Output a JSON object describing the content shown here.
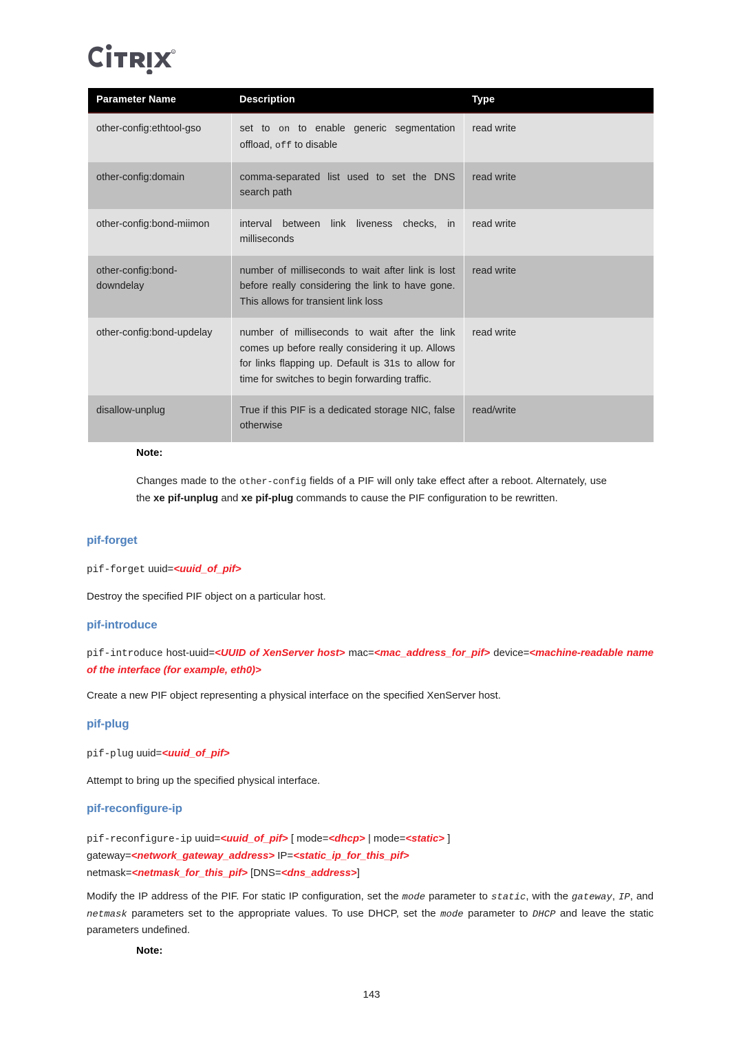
{
  "brand": {
    "logo_text": "CITRIX",
    "logo_color": "#4a4a55"
  },
  "theme": {
    "heading_blue": "#4f81bd",
    "placeholder_red": "#ee1c24",
    "row_light": "#e0e0e0",
    "row_dark": "#bfbfbf",
    "header_bg": "#000000"
  },
  "table": {
    "headers": [
      "Parameter Name",
      "Description",
      "Type"
    ],
    "rows": [
      {
        "name": "other-config:ethtool-gso",
        "desc_parts": [
          {
            "text": "set to ",
            "style": "normal"
          },
          {
            "text": "on",
            "style": "mono"
          },
          {
            "text": " to enable generic segmentation offload, ",
            "style": "normal"
          },
          {
            "text": "off",
            "style": "mono"
          },
          {
            "text": " to disable",
            "style": "normal"
          }
        ],
        "desc_plain": "set to on to enable generic segmentation offload, off to disable",
        "type": "read write",
        "shade": "light"
      },
      {
        "name": "other-config:domain",
        "desc_plain": "comma-separated list used to set the DNS search path",
        "type": "read write",
        "shade": "dark"
      },
      {
        "name": "other-config:bond-miimon",
        "desc_plain": "interval between link liveness checks, in milliseconds",
        "type": "read write",
        "shade": "light"
      },
      {
        "name": "other-config:bond-downdelay",
        "desc_plain": "number of milliseconds to wait after link is lost before really considering the link to have gone. This allows for transient link loss",
        "type": "read write",
        "shade": "dark"
      },
      {
        "name": "other-config:bond-updelay",
        "desc_plain": "number of milliseconds to wait after the link comes up before really considering it up. Allows for links flapping up. Default is 31s to allow for time for switches to begin forwarding traffic.",
        "type": "read write",
        "shade": "light"
      },
      {
        "name": "disallow-unplug",
        "desc_plain": "True if this PIF is a dedicated storage NIC, false otherwise",
        "type": "read/write",
        "shade": "dark"
      }
    ]
  },
  "note_top": {
    "label": "Note:",
    "line1_a": "Changes made to the ",
    "line1_mono": "other-config",
    "line1_b": " fields of a PIF will only take effect after a reboot. Alternately, use the ",
    "bold1": "xe pif-unplug",
    "mid": " and ",
    "bold2": "xe pif-plug",
    "line1_c": " commands to cause the PIF configuration to be rewritten."
  },
  "sections": {
    "pif_forget": {
      "heading": "pif-forget",
      "syntax_cmd": "pif-forget",
      "syntax_arg": "uuid=",
      "syntax_ph": "<uuid_of_pif>",
      "body": "Destroy the specified PIF object on a particular host."
    },
    "pif_introduce": {
      "heading": "pif-introduce",
      "syntax_cmd": "pif-introduce",
      "arg1": "host-uuid=",
      "ph1": "<UUID of XenServer host>",
      "arg2": "mac=",
      "ph2": "<mac_address_for_pif>",
      "arg3": "device=",
      "ph3": "<machine-readable name of the interface (for example, eth0)>",
      "body": "Create a new PIF object representing a physical interface on the specified XenServer host."
    },
    "pif_plug": {
      "heading": "pif-plug",
      "syntax_cmd": "pif-plug",
      "syntax_arg": "uuid=",
      "syntax_ph": "<uuid_of_pif>",
      "body": "Attempt to bring up the specified physical interface."
    },
    "pif_reconfigure_ip": {
      "heading": "pif-reconfigure-ip",
      "syntax_cmd": "pif-reconfigure-ip",
      "l1_arg": "uuid=",
      "l1_ph": "<uuid_of_pif>",
      "l1_open": " [ mode=",
      "l1_ph2": "<dhcp>",
      "l1_pipe": " | mode=",
      "l1_ph3": "<static>",
      "l1_close": " ]",
      "l2_arg1": "gateway=",
      "l2_ph1": "<network_gateway_address>",
      "l2_arg2": " IP=",
      "l2_ph2": "<static_ip_for_this_pif>",
      "l3_arg1": "netmask=",
      "l3_ph1": "<netmask_for_this_pif>",
      "l3_arg2": " [DNS=",
      "l3_ph2": "<dns_address>",
      "l3_close": "]",
      "body_a": "Modify the IP address of the PIF. For static IP configuration, set the ",
      "body_m1": "mode",
      "body_b": " parameter to ",
      "body_m2": "static",
      "body_c": ", with the ",
      "body_m3": "gateway",
      "body_d": ", ",
      "body_m4": "IP",
      "body_e": ", and ",
      "body_m5": "netmask",
      "body_f": " parameters set to the appropriate values. To use DHCP, set the ",
      "body_m6": "mode",
      "body_g": " parameter to ",
      "body_m7": "DHCP",
      "body_h": " and leave the static parameters undefined."
    }
  },
  "note_bottom": {
    "label": "Note:"
  },
  "footer": {
    "page_number": "143"
  }
}
